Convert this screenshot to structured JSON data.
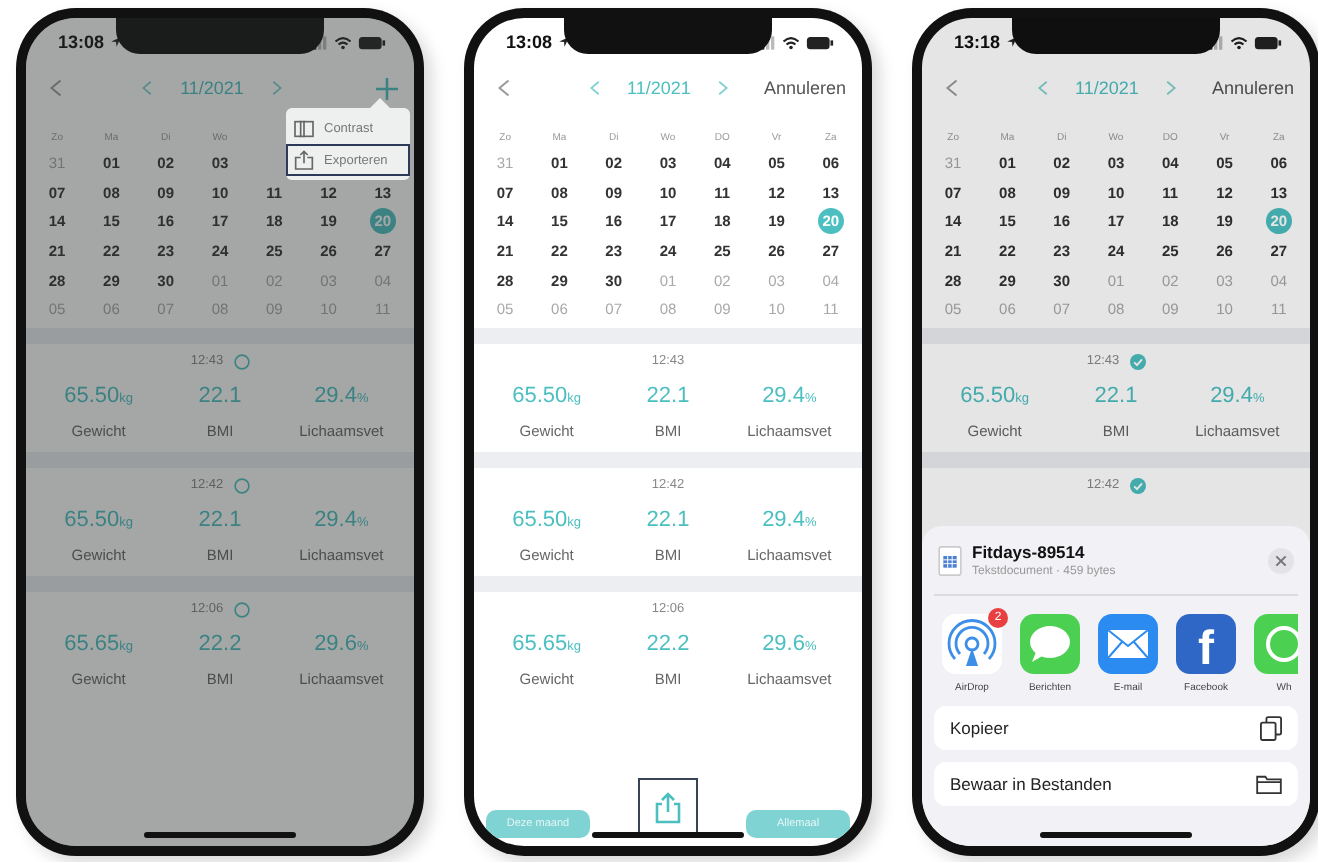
{
  "phones": [
    {
      "status_time": "13:08",
      "dimmed": true,
      "header": {
        "title": "11/2021",
        "action": {
          "kind": "icon"
        }
      },
      "weekdays": [
        "Zo",
        "Ma",
        "Di",
        "Wo"
      ],
      "weeks": [
        [
          {
            "label": "31",
            "outside": true,
            "selected": false
          },
          {
            "label": "01",
            "outside": false,
            "selected": false
          },
          {
            "label": "02",
            "outside": false,
            "selected": false
          },
          {
            "label": "03",
            "outside": false,
            "selected": false
          }
        ],
        [
          {
            "label": "07",
            "outside": false,
            "selected": false
          },
          {
            "label": "08",
            "outside": false,
            "selected": false
          },
          {
            "label": "09",
            "outside": false,
            "selected": false
          },
          {
            "label": "10",
            "outside": false,
            "selected": false
          },
          {
            "label": "11",
            "outside": false,
            "selected": false
          },
          {
            "label": "12",
            "outside": false,
            "selected": false
          },
          {
            "label": "13",
            "outside": false,
            "selected": false
          }
        ],
        [
          {
            "label": "14",
            "outside": false,
            "selected": false
          },
          {
            "label": "15",
            "outside": false,
            "selected": false
          },
          {
            "label": "16",
            "outside": false,
            "selected": false
          },
          {
            "label": "17",
            "outside": false,
            "selected": false
          },
          {
            "label": "18",
            "outside": false,
            "selected": false
          },
          {
            "label": "19",
            "outside": false,
            "selected": false
          },
          {
            "label": "20",
            "outside": false,
            "selected": true
          }
        ],
        [
          {
            "label": "21",
            "outside": false,
            "selected": false
          },
          {
            "label": "22",
            "outside": false,
            "selected": false
          },
          {
            "label": "23",
            "outside": false,
            "selected": false
          },
          {
            "label": "24",
            "outside": false,
            "selected": false
          },
          {
            "label": "25",
            "outside": false,
            "selected": false
          },
          {
            "label": "26",
            "outside": false,
            "selected": false
          },
          {
            "label": "27",
            "outside": false,
            "selected": false
          }
        ],
        [
          {
            "label": "28",
            "outside": false,
            "selected": false
          },
          {
            "label": "29",
            "outside": false,
            "selected": false
          },
          {
            "label": "30",
            "outside": false,
            "selected": false
          },
          {
            "label": "01",
            "outside": true,
            "selected": false
          },
          {
            "label": "02",
            "outside": true,
            "selected": false
          },
          {
            "label": "03",
            "outside": true,
            "selected": false
          },
          {
            "label": "04",
            "outside": true,
            "selected": false
          }
        ],
        [
          {
            "label": "05",
            "outside": true,
            "selected": false
          },
          {
            "label": "06",
            "outside": true,
            "selected": false
          },
          {
            "label": "07",
            "outside": true,
            "selected": false
          },
          {
            "label": "08",
            "outside": true,
            "selected": false
          },
          {
            "label": "09",
            "outside": true,
            "selected": false
          },
          {
            "label": "10",
            "outside": true,
            "selected": false
          },
          {
            "label": "11",
            "outside": true,
            "selected": false
          }
        ]
      ],
      "entries": [
        {
          "time": "12:43",
          "checked": false,
          "metrics": [
            {
              "value": "65.50",
              "unit": "kg",
              "label": "Gewicht"
            },
            {
              "value": "22.1",
              "label": "BMI"
            },
            {
              "value": "29.4",
              "unit": "%",
              "label": "Lichaamsvet"
            }
          ]
        },
        {
          "time": "12:42",
          "checked": false,
          "metrics": [
            {
              "value": "65.50",
              "unit": "kg",
              "label": "Gewicht"
            },
            {
              "value": "22.1",
              "label": "BMI"
            },
            {
              "value": "29.4",
              "unit": "%",
              "label": "Lichaamsvet"
            }
          ]
        },
        {
          "time": "12:06",
          "checked": false,
          "metrics": [
            {
              "value": "65.65",
              "unit": "kg",
              "label": "Gewicht"
            },
            {
              "value": "22.2",
              "label": "BMI"
            },
            {
              "value": "29.6",
              "unit": "%",
              "label": "Lichaamsvet"
            }
          ]
        }
      ],
      "menu": [
        {
          "kind": "contrast",
          "label": "Contrast",
          "selected": false
        },
        {
          "kind": "export",
          "label": "Exporteren",
          "selected": true
        }
      ]
    },
    {
      "status_time": "13:08",
      "header": {
        "title": "11/2021",
        "action": {
          "kind": "text",
          "label": "Annuleren"
        }
      },
      "weekdays": [
        "Zo",
        "Ma",
        "Di",
        "Wo",
        "DO",
        "Vr",
        "Za"
      ],
      "weeks": [
        [
          {
            "label": "31",
            "outside": true,
            "selected": false
          },
          {
            "label": "01",
            "outside": false,
            "selected": false
          },
          {
            "label": "02",
            "outside": false,
            "selected": false
          },
          {
            "label": "03",
            "outside": false,
            "selected": false
          },
          {
            "label": "04",
            "outside": false,
            "selected": false
          },
          {
            "label": "05",
            "outside": false,
            "selected": false
          },
          {
            "label": "06",
            "outside": false,
            "selected": false
          }
        ],
        [
          {
            "label": "07",
            "outside": false,
            "selected": false
          },
          {
            "label": "08",
            "outside": false,
            "selected": false
          },
          {
            "label": "09",
            "outside": false,
            "selected": false
          },
          {
            "label": "10",
            "outside": false,
            "selected": false
          },
          {
            "label": "11",
            "outside": false,
            "selected": false
          },
          {
            "label": "12",
            "outside": false,
            "selected": false
          },
          {
            "label": "13",
            "outside": false,
            "selected": false
          }
        ],
        [
          {
            "label": "14",
            "outside": false,
            "selected": false
          },
          {
            "label": "15",
            "outside": false,
            "selected": false
          },
          {
            "label": "16",
            "outside": false,
            "selected": false
          },
          {
            "label": "17",
            "outside": false,
            "selected": false
          },
          {
            "label": "18",
            "outside": false,
            "selected": false
          },
          {
            "label": "19",
            "outside": false,
            "selected": false
          },
          {
            "label": "20",
            "outside": false,
            "selected": true
          }
        ],
        [
          {
            "label": "21",
            "outside": false,
            "selected": false
          },
          {
            "label": "22",
            "outside": false,
            "selected": false
          },
          {
            "label": "23",
            "outside": false,
            "selected": false
          },
          {
            "label": "24",
            "outside": false,
            "selected": false
          },
          {
            "label": "25",
            "outside": false,
            "selected": false
          },
          {
            "label": "26",
            "outside": false,
            "selected": false
          },
          {
            "label": "27",
            "outside": false,
            "selected": false
          }
        ],
        [
          {
            "label": "28",
            "outside": false,
            "selected": false
          },
          {
            "label": "29",
            "outside": false,
            "selected": false
          },
          {
            "label": "30",
            "outside": false,
            "selected": false
          },
          {
            "label": "01",
            "outside": true,
            "selected": false
          },
          {
            "label": "02",
            "outside": true,
            "selected": false
          },
          {
            "label": "03",
            "outside": true,
            "selected": false
          },
          {
            "label": "04",
            "outside": true,
            "selected": false
          }
        ],
        [
          {
            "label": "05",
            "outside": true,
            "selected": false
          },
          {
            "label": "06",
            "outside": true,
            "selected": false
          },
          {
            "label": "07",
            "outside": true,
            "selected": false
          },
          {
            "label": "08",
            "outside": true,
            "selected": false
          },
          {
            "label": "09",
            "outside": true,
            "selected": false
          },
          {
            "label": "10",
            "outside": true,
            "selected": false
          },
          {
            "label": "11",
            "outside": true,
            "selected": false
          }
        ]
      ],
      "entries": [
        {
          "time": "12:43",
          "metrics": [
            {
              "value": "65.50",
              "unit": "kg",
              "label": "Gewicht"
            },
            {
              "value": "22.1",
              "label": "BMI"
            },
            {
              "value": "29.4",
              "unit": "%",
              "label": "Lichaamsvet"
            }
          ]
        },
        {
          "time": "12:42",
          "metrics": [
            {
              "value": "65.50",
              "unit": "kg",
              "label": "Gewicht"
            },
            {
              "value": "22.1",
              "label": "BMI"
            },
            {
              "value": "29.4",
              "unit": "%",
              "label": "Lichaamsvet"
            }
          ]
        },
        {
          "time": "12:06",
          "metrics": [
            {
              "value": "65.65",
              "unit": "kg",
              "label": "Gewicht"
            },
            {
              "value": "22.2",
              "label": "BMI"
            },
            {
              "value": "29.6",
              "unit": "%",
              "label": "Lichaamsvet"
            }
          ]
        }
      ],
      "footer": {
        "buttons": [
          {
            "label": "Deze maand"
          },
          {
            "label": "Allemaal"
          }
        ],
        "export_selected": true
      }
    },
    {
      "status_time": "13:18",
      "dimmed": true,
      "header": {
        "title": "11/2021",
        "action": {
          "kind": "text",
          "label": "Annuleren"
        }
      },
      "weekdays": [
        "Zo",
        "Ma",
        "Di",
        "Wo",
        "DO",
        "Vr",
        "Za"
      ],
      "weeks": [
        [
          {
            "label": "31",
            "outside": true,
            "selected": false
          },
          {
            "label": "01",
            "outside": false,
            "selected": false
          },
          {
            "label": "02",
            "outside": false,
            "selected": false
          },
          {
            "label": "03",
            "outside": false,
            "selected": false
          },
          {
            "label": "04",
            "outside": false,
            "selected": false
          },
          {
            "label": "05",
            "outside": false,
            "selected": false
          },
          {
            "label": "06",
            "outside": false,
            "selected": false
          }
        ],
        [
          {
            "label": "07",
            "outside": false,
            "selected": false
          },
          {
            "label": "08",
            "outside": false,
            "selected": false
          },
          {
            "label": "09",
            "outside": false,
            "selected": false
          },
          {
            "label": "10",
            "outside": false,
            "selected": false
          },
          {
            "label": "11",
            "outside": false,
            "selected": false
          },
          {
            "label": "12",
            "outside": false,
            "selected": false
          },
          {
            "label": "13",
            "outside": false,
            "selected": false
          }
        ],
        [
          {
            "label": "14",
            "outside": false,
            "selected": false
          },
          {
            "label": "15",
            "outside": false,
            "selected": false
          },
          {
            "label": "16",
            "outside": false,
            "selected": false
          },
          {
            "label": "17",
            "outside": false,
            "selected": false
          },
          {
            "label": "18",
            "outside": false,
            "selected": false
          },
          {
            "label": "19",
            "outside": false,
            "selected": false
          },
          {
            "label": "20",
            "outside": false,
            "selected": true
          }
        ],
        [
          {
            "label": "21",
            "outside": false,
            "selected": false
          },
          {
            "label": "22",
            "outside": false,
            "selected": false
          },
          {
            "label": "23",
            "outside": false,
            "selected": false
          },
          {
            "label": "24",
            "outside": false,
            "selected": false
          },
          {
            "label": "25",
            "outside": false,
            "selected": false
          },
          {
            "label": "26",
            "outside": false,
            "selected": false
          },
          {
            "label": "27",
            "outside": false,
            "selected": false
          }
        ],
        [
          {
            "label": "28",
            "outside": false,
            "selected": false
          },
          {
            "label": "29",
            "outside": false,
            "selected": false
          },
          {
            "label": "30",
            "outside": false,
            "selected": false
          },
          {
            "label": "01",
            "outside": true,
            "selected": false
          },
          {
            "label": "02",
            "outside": true,
            "selected": false
          },
          {
            "label": "03",
            "outside": true,
            "selected": false
          },
          {
            "label": "04",
            "outside": true,
            "selected": false
          }
        ],
        [
          {
            "label": "05",
            "outside": true,
            "selected": false
          },
          {
            "label": "06",
            "outside": true,
            "selected": false
          },
          {
            "label": "07",
            "outside": true,
            "selected": false
          },
          {
            "label": "08",
            "outside": true,
            "selected": false
          },
          {
            "label": "09",
            "outside": true,
            "selected": false
          },
          {
            "label": "10",
            "outside": true,
            "selected": false
          },
          {
            "label": "11",
            "outside": true,
            "selected": false
          }
        ]
      ],
      "entries": [
        {
          "time": "12:43",
          "checked": true,
          "metrics": [
            {
              "value": "65.50",
              "unit": "kg",
              "label": "Gewicht"
            },
            {
              "value": "22.1",
              "label": "BMI"
            },
            {
              "value": "29.4",
              "unit": "%",
              "label": "Lichaamsvet"
            }
          ]
        },
        {
          "time": "12:42",
          "checked": true
        }
      ],
      "share_sheet": {
        "file_name": "Fitdays-89514",
        "file_detail": "Tekstdocument · 459 bytes",
        "apps": [
          {
            "kind": "airdrop",
            "label": "AirDrop",
            "badge": "2"
          },
          {
            "kind": "messages",
            "label": "Berichten"
          },
          {
            "kind": "mail",
            "label": "E-mail"
          },
          {
            "kind": "facebook",
            "label": "Facebook",
            "glyph": "f"
          },
          {
            "kind": "chat",
            "label": "Wh"
          }
        ],
        "actions": [
          {
            "kind": "copy",
            "label": "Kopieer"
          },
          {
            "kind": "folder",
            "label": "Bewaar in Bestanden"
          }
        ]
      }
    }
  ]
}
